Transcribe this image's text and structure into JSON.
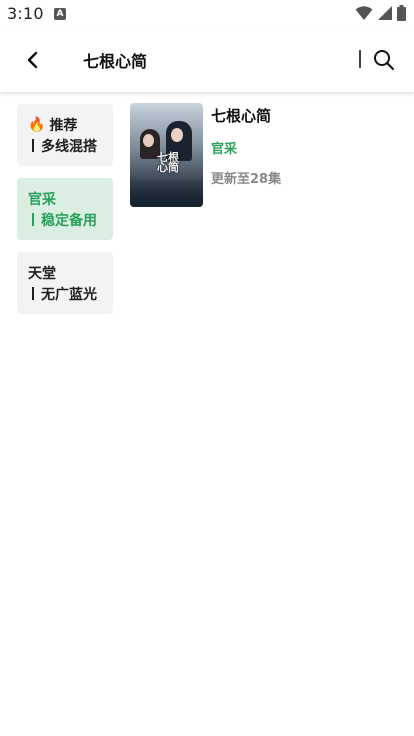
{
  "status_bar": {
    "time": "3:10",
    "app_icon_glyph": "A",
    "icons": [
      "wifi-icon",
      "signal-icon",
      "battery-icon"
    ]
  },
  "appbar": {
    "title": "七根心简",
    "back_icon": "chevron-left-icon",
    "search_icon": "search-icon"
  },
  "sources": [
    {
      "name": "推荐",
      "desc": "多线混搭",
      "icon": "fire-icon",
      "active": false
    },
    {
      "name": "官采",
      "desc": "稳定备用",
      "icon": "",
      "active": true
    },
    {
      "name": "天堂",
      "desc": "无广蓝光",
      "icon": "",
      "active": false
    }
  ],
  "results": [
    {
      "title": "七根心简",
      "source": "官采",
      "update": "更新至28集",
      "poster_text": "七根心简"
    }
  ],
  "colors": {
    "accent": "#2aa15a",
    "active_bg": "#dbeee2",
    "item_bg": "#f3f3f6",
    "muted": "#8a8a8a"
  }
}
